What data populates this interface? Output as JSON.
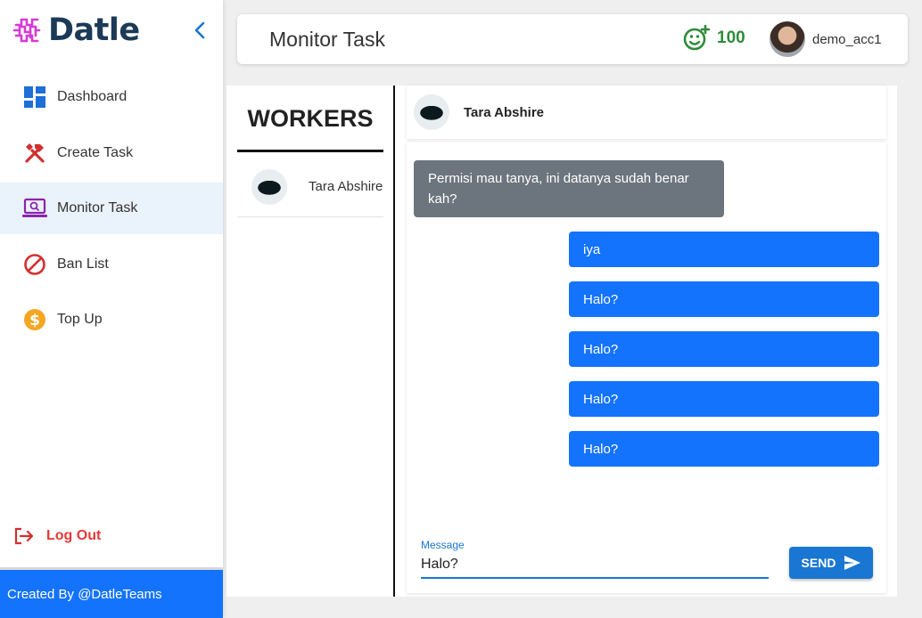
{
  "app": {
    "name": "Datle"
  },
  "sidebar": {
    "items": [
      {
        "label": "Dashboard",
        "icon": "dashboard-icon"
      },
      {
        "label": "Create Task",
        "icon": "tools-icon"
      },
      {
        "label": "Monitor Task",
        "icon": "laptop-search-icon",
        "active": true
      },
      {
        "label": "Ban List",
        "icon": "ban-icon"
      },
      {
        "label": "Top Up",
        "icon": "dollar-icon"
      }
    ],
    "logout_label": "Log Out",
    "credit": "Created By @DatleTeams"
  },
  "header": {
    "title": "Monitor Task",
    "points": "100",
    "username": "demo_acc1"
  },
  "workers": {
    "title": "WORKERS",
    "list": [
      {
        "name": "Tara Abshire"
      }
    ]
  },
  "chat": {
    "contact_name": "Tara Abshire",
    "incoming": [
      "Permisi mau tanya, ini datanya sudah benar kah?"
    ],
    "outgoing": [
      "iya",
      "Halo?",
      "Halo?",
      "Halo?",
      "Halo?"
    ],
    "input_label": "Message",
    "input_value": "Halo?",
    "send_label": "SEND"
  },
  "colors": {
    "brand_blue": "#1473fc",
    "primary": "#1976d2",
    "incoming_bubble": "#6c757d",
    "points_green": "#2e8b3a",
    "logout_red": "#e53935"
  }
}
